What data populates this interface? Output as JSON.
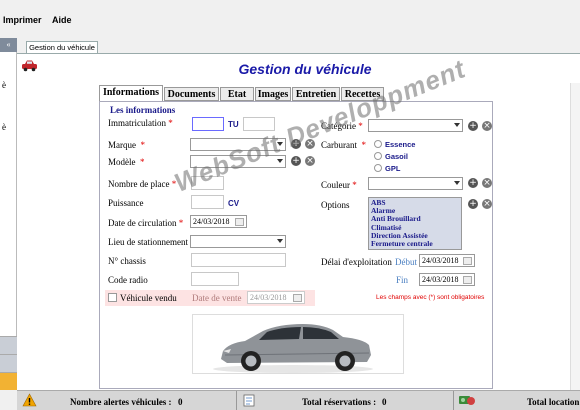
{
  "menu": {
    "items": [
      "Imprimer",
      "Aide"
    ]
  },
  "document_tab": {
    "label": "Gestion du véhicule"
  },
  "page_title": "Gestion du véhicule",
  "tabs": [
    {
      "label": "Informations",
      "active": true
    },
    {
      "label": "Documents",
      "active": false
    },
    {
      "label": "Etat",
      "active": false
    },
    {
      "label": "Images",
      "active": false
    },
    {
      "label": "Entretien",
      "active": false
    },
    {
      "label": "Recettes",
      "active": false
    }
  ],
  "form": {
    "section_title": "Les informations",
    "immatriculation": {
      "label": "Immatriculation",
      "value1": "",
      "unit": "TU",
      "value2": ""
    },
    "marque": {
      "label": "Marque",
      "value": ""
    },
    "modele": {
      "label": "Modèle",
      "value": ""
    },
    "nombre_place": {
      "label": "Nombre de place",
      "value": ""
    },
    "puissance": {
      "label": "Puissance",
      "value": "",
      "unit": "CV"
    },
    "date_circulation": {
      "label": "Date de circulation",
      "value": "24/03/2018"
    },
    "lieu_stationnement": {
      "label": "Lieu de stationnement",
      "value": ""
    },
    "chassis": {
      "label": "N° chassis",
      "value": ""
    },
    "code_radio": {
      "label": "Code radio",
      "value": ""
    },
    "vendu": {
      "label": "Véhicule vendu",
      "checked": false,
      "date_label": "Date de vente",
      "date_value": "24/03/2018"
    },
    "categorie": {
      "label": "Catégorie",
      "value": ""
    },
    "carburant": {
      "label": "Carburant",
      "options": [
        "Essence",
        "Gasoil",
        "GPL"
      ]
    },
    "couleur": {
      "label": "Couleur",
      "value": ""
    },
    "options": {
      "label": "Options",
      "items": [
        "ABS",
        "Alarme",
        "Anti Brouillard",
        "Climatisé",
        "Direction Assistée",
        "Fermeture centrale"
      ]
    },
    "delai_exploitation": {
      "label": "Délai d'exploitation",
      "debut_label": "Début",
      "debut_value": "24/03/2018",
      "fin_label": "Fin",
      "fin_value": "24/03/2018"
    },
    "required_notice": "Les champs avec (*) sont obligatoires",
    "required_mark": "*"
  },
  "watermark": "WebSoft Developpment",
  "status": {
    "alertes_label": "Nombre alertes véhicules :",
    "alertes_value": "0",
    "reservations_label": "Total réservations :",
    "reservations_value": "0",
    "location_label": "Total location"
  },
  "colors": {
    "title": "#1a1aa8",
    "required": "#e00000",
    "label_blue": "#1a1a8a",
    "vendu_bg": "#fde3e3"
  }
}
